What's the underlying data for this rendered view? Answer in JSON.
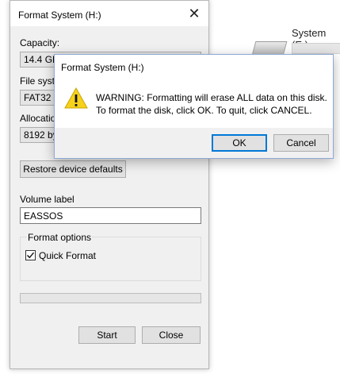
{
  "background": {
    "drive_label": "System (E:)"
  },
  "format_window": {
    "title": "Format System (H:)",
    "close_glyph": "✕",
    "capacity_label": "Capacity:",
    "capacity_value": "14.4 GB",
    "filesystem_label": "File system",
    "filesystem_value": "FAT32 (Default)",
    "allocation_label": "Allocation unit size",
    "allocation_value": "8192 bytes",
    "restore_button": "Restore device defaults",
    "volume_label_label": "Volume label",
    "volume_label_value": "EASSOS",
    "format_options_label": "Format options",
    "quick_format_label": "Quick Format",
    "quick_format_checked": true,
    "progress": 0,
    "start_button": "Start",
    "close_button": "Close"
  },
  "warning_dialog": {
    "title": "Format System (H:)",
    "line1": "WARNING: Formatting will erase ALL data on this disk.",
    "line2": "To format the disk, click OK. To quit, click CANCEL.",
    "icon": "warning-icon",
    "ok_button": "OK",
    "cancel_button": "Cancel"
  },
  "colors": {
    "warning_yellow": "#f7d21c",
    "focus_blue": "#0078d7"
  }
}
